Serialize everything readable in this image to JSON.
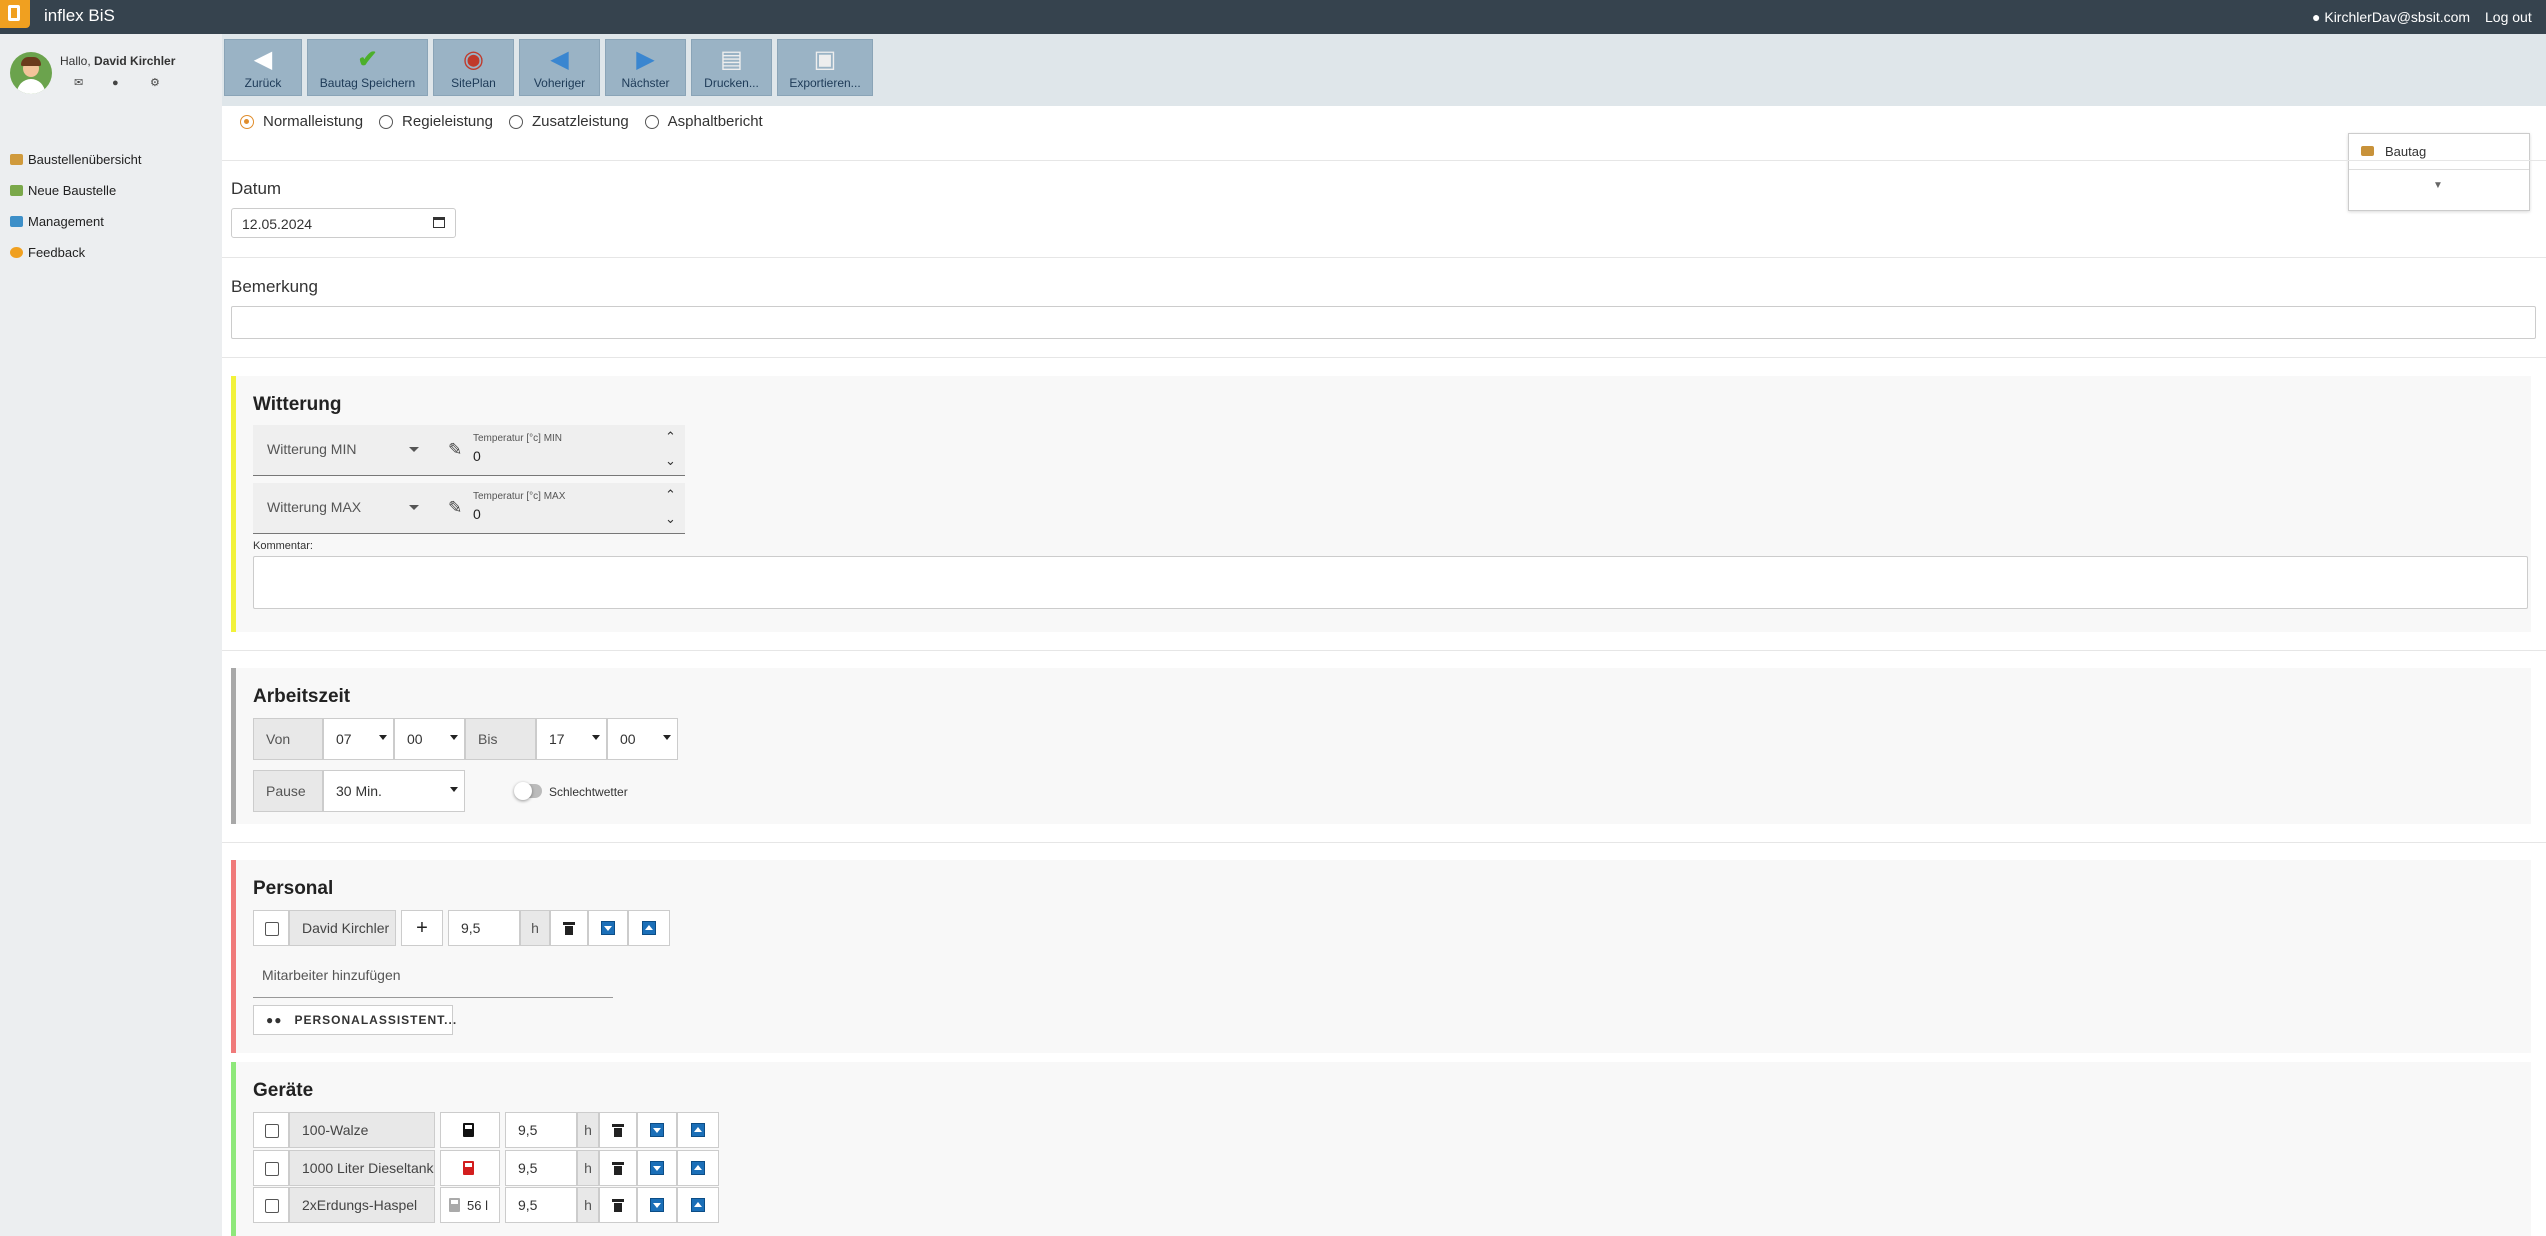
{
  "app": {
    "title": "inflex BiS",
    "user_email": "KirchlerDav@sbsit.com",
    "logout": "Log out"
  },
  "sidebar": {
    "greeting_prefix": "Hallo,",
    "greeting_name": "David Kirchler",
    "items": [
      {
        "label": "Baustellenübersicht"
      },
      {
        "label": "Neue Baustelle"
      },
      {
        "label": "Management"
      },
      {
        "label": "Feedback"
      }
    ]
  },
  "toolbar": {
    "buttons": [
      {
        "label": "Zurück"
      },
      {
        "label": "Bautag Speichern"
      },
      {
        "label": "SitePlan"
      },
      {
        "label": "Voheriger"
      },
      {
        "label": "Nächster"
      },
      {
        "label": "Drucken..."
      },
      {
        "label": "Exportieren..."
      }
    ]
  },
  "leistung": {
    "options": [
      "Normalleistung",
      "Regieleistung",
      "Zusatzleistung",
      "Asphaltbericht"
    ],
    "selected": "Normalleistung"
  },
  "bautag_panel": {
    "label": "Bautag"
  },
  "datum": {
    "label": "Datum",
    "value": "12.05.2024"
  },
  "bemerkung": {
    "label": "Bemerkung",
    "value": ""
  },
  "witterung": {
    "title": "Witterung",
    "rows": [
      {
        "select": "Witterung MIN",
        "temp_label": "Temperatur [°c] MIN",
        "temp_value": "0"
      },
      {
        "select": "Witterung MAX",
        "temp_label": "Temperatur [°c] MAX",
        "temp_value": "0"
      }
    ],
    "kommentar_label": "Kommentar:"
  },
  "arbeitszeit": {
    "title": "Arbeitszeit",
    "von_label": "Von",
    "von_hour": "07",
    "von_min": "00",
    "bis_label": "Bis",
    "bis_hour": "17",
    "bis_min": "00",
    "pause_label": "Pause",
    "pause_value": "30 Min.",
    "schlechtwetter_label": "Schlechtwetter"
  },
  "personal": {
    "title": "Personal",
    "rows": [
      {
        "name": "David Kirchler",
        "plus": "+",
        "hours": "9,5",
        "unit": "h"
      }
    ],
    "add_placeholder": "Mitarbeiter hinzufügen",
    "assistant_button": "PERSONALASSISTENT..."
  },
  "geraete": {
    "title": "Geräte",
    "rows": [
      {
        "name": "100-Walze",
        "fuel": "",
        "hours": "9,5",
        "unit": "h"
      },
      {
        "name": "1000 Liter Dieseltank",
        "fuel": "",
        "hours": "9,5",
        "unit": "h"
      },
      {
        "name": "2xErdungs-Haspel",
        "fuel": "56 l",
        "hours": "9,5",
        "unit": "h"
      }
    ]
  },
  "colors": {
    "topbar": "#36434e",
    "accent": "#e08d2c",
    "witterung_border": "#f2f23a",
    "arbeitszeit_border": "#a8a8a8",
    "personal_border": "#f07a7a",
    "geraete_border": "#8ee87a",
    "blue_button": "#1b6fb8"
  }
}
